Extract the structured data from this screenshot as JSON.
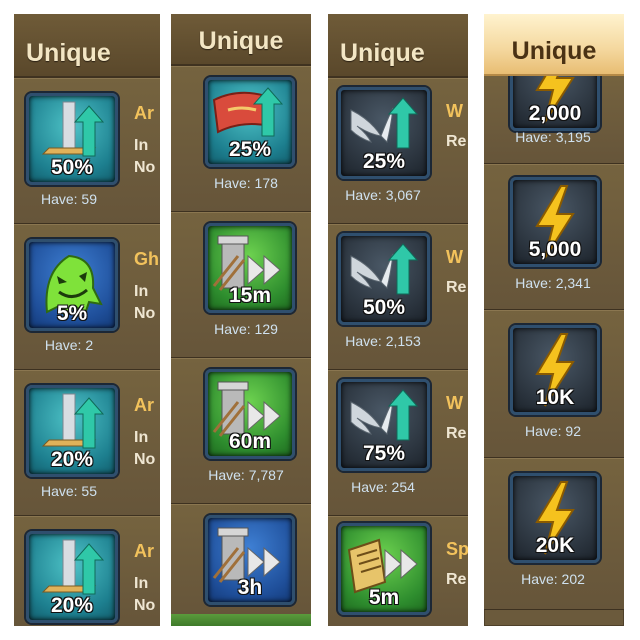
{
  "panels": [
    {
      "header": "Unique",
      "items": [
        {
          "value": "50%",
          "have": "Have: 59",
          "name": "Ar",
          "line1": "In",
          "line2": "No"
        },
        {
          "value": "5%",
          "have": "Have: 2",
          "name": "Gh",
          "line1": "In",
          "line2": "No"
        },
        {
          "value": "20%",
          "have": "Have: 55",
          "name": "Ar",
          "line1": "In",
          "line2": "No"
        },
        {
          "value": "20%",
          "have": "",
          "name": "Ar",
          "line1": "In",
          "line2": "No"
        }
      ]
    },
    {
      "header": "Unique",
      "items": [
        {
          "value": "25%",
          "have": "Have: 178"
        },
        {
          "value": "15m",
          "have": "Have: 129"
        },
        {
          "value": "60m",
          "have": "Have: 7,787"
        },
        {
          "value": "3h",
          "have": ""
        }
      ]
    },
    {
      "header": "Unique",
      "items": [
        {
          "value": "25%",
          "have": "Have: 3,067",
          "name": "W",
          "line1": "Re"
        },
        {
          "value": "50%",
          "have": "Have: 2,153",
          "name": "W",
          "line1": "Re"
        },
        {
          "value": "75%",
          "have": "Have: 254",
          "name": "W",
          "line1": "Re"
        },
        {
          "value": "5m",
          "have": "",
          "name": "Sp",
          "line1": "Re"
        }
      ]
    },
    {
      "header": "Unique",
      "items": [
        {
          "value": "2,000",
          "have": "Have: 3,195"
        },
        {
          "value": "5,000",
          "have": "Have: 2,341"
        },
        {
          "value": "10K",
          "have": "Have: 92"
        },
        {
          "value": "20K",
          "have": "Have: 202"
        }
      ]
    }
  ]
}
